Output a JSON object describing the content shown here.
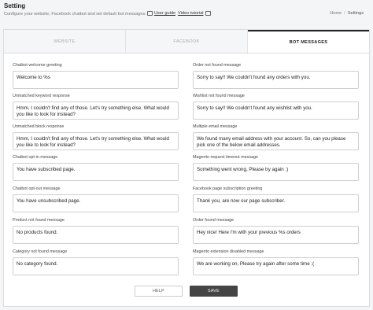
{
  "header": {
    "title": "Setting",
    "subtitle": "Configure your website, Facebook chatbot and set default bot messages.",
    "user_guide": "User guide",
    "video_tutorial": "Video tutorial",
    "breadcrumb_home": "Home",
    "breadcrumb_sep": "/",
    "breadcrumb_current": "Settings"
  },
  "tabs": [
    {
      "label": "WEBSITE",
      "active": false
    },
    {
      "label": "FACEBOOK",
      "active": false
    },
    {
      "label": "BOT MESSAGES",
      "active": true
    }
  ],
  "fields_left": [
    {
      "label": "Chatbot welcome greeting",
      "value": "Welcome to %s"
    },
    {
      "label": "Unmatched keyword response",
      "value": "Hmm, I couldn't find any of those. Let's try something else. What would you like to look for instead?"
    },
    {
      "label": "Unmatched block response",
      "value": "Hmm, I couldn't find any of those. Let's try something else. What would you like to look for instead?"
    },
    {
      "label": "Chatbot opt-in message",
      "value": "You have subscribed page."
    },
    {
      "label": "Chatbot opt-out message",
      "value": "You have unsubscribed page."
    },
    {
      "label": "Product not found message",
      "value": "No products found."
    },
    {
      "label": "Category not found message",
      "value": "No category found."
    }
  ],
  "fields_right": [
    {
      "label": "Order not found message",
      "value": "Sorry to say!! We couldn't found any orders with you."
    },
    {
      "label": "Wishlist not found message",
      "value": "Sorry to say!! We couldn't found any wishlist with you."
    },
    {
      "label": "Multiple email message",
      "value": "We found many email address with your account. So, can you please pick one of the below email addresses."
    },
    {
      "label": "Magento request timeout message",
      "value": "Something went wrong, Please try again :)"
    },
    {
      "label": "Facebook page subscription greeting",
      "value": "Thank you, are now our page subscriber."
    },
    {
      "label": "Order found message",
      "value": "Hey nice! Here I'm with your previous %s orders"
    },
    {
      "label": "Magento extension disabled message",
      "value": "We are working on, Please try again after some time :("
    }
  ],
  "buttons": {
    "help": "HELP",
    "save": "SAVE"
  },
  "colors": {
    "accent": "#444444",
    "background": "#f4f5f7",
    "card": "#ffffff"
  }
}
